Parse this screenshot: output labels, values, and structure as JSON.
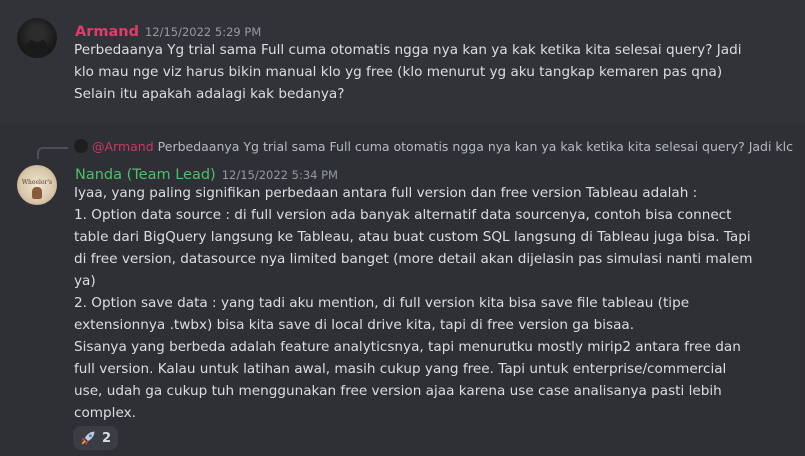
{
  "messages": [
    {
      "author": "Armand",
      "timestamp": "12/15/2022 5:29 PM",
      "author_color": "#e23b6a",
      "lines": [
        "Perbedaanya Yg trial sama Full cuma otomatis ngga nya kan ya kak ketika kita selesai query? Jadi",
        "klo mau nge viz harus bikin manual klo yg free (klo menurut yg aku tangkap kemaren pas qna)",
        "Selain itu apakah adalagi kak bedanya?"
      ]
    },
    {
      "reply": {
        "mention": "@Armand",
        "preview": "Perbedaanya Yg trial sama Full cuma otomatis ngga nya kan ya kak ketika kita selesai query? Jadi klc"
      },
      "author": "Nanda (Team Lead)",
      "timestamp": "12/15/2022 5:34 PM",
      "author_color": "#4fbf6b",
      "avatar_text": "Wheeler's",
      "lines": [
        "Iyaa, yang paling signifikan perbedaan antara full version dan free version Tableau adalah :",
        "1. Option data source : di full version ada banyak alternatif data sourcenya, contoh bisa connect",
        "table dari BigQuery langsung ke Tableau, atau buat custom SQL langsung di Tableau juga bisa. Tapi",
        "di free version, datasource nya limited banget (more detail akan dijelasin pas simulasi nanti malem",
        "ya)",
        "2. Option save data : yang tadi aku mention, di full version kita bisa save file tableau (tipe",
        "extensionnya .twbx) bisa kita save di local drive kita, tapi di free version ga bisaa.",
        "Sisanya yang berbeda adalah feature analyticsnya, tapi menurutku mostly mirip2 antara free dan",
        "full version. Kalau untuk latihan awal, masih cukup yang free. Tapi untuk enterprise/commercial",
        "use, udah ga cukup tuh menggunakan free version ajaa karena use case analisanya pasti lebih",
        "complex."
      ],
      "reaction": {
        "icon": "rocket-icon",
        "count": "2"
      }
    }
  ]
}
